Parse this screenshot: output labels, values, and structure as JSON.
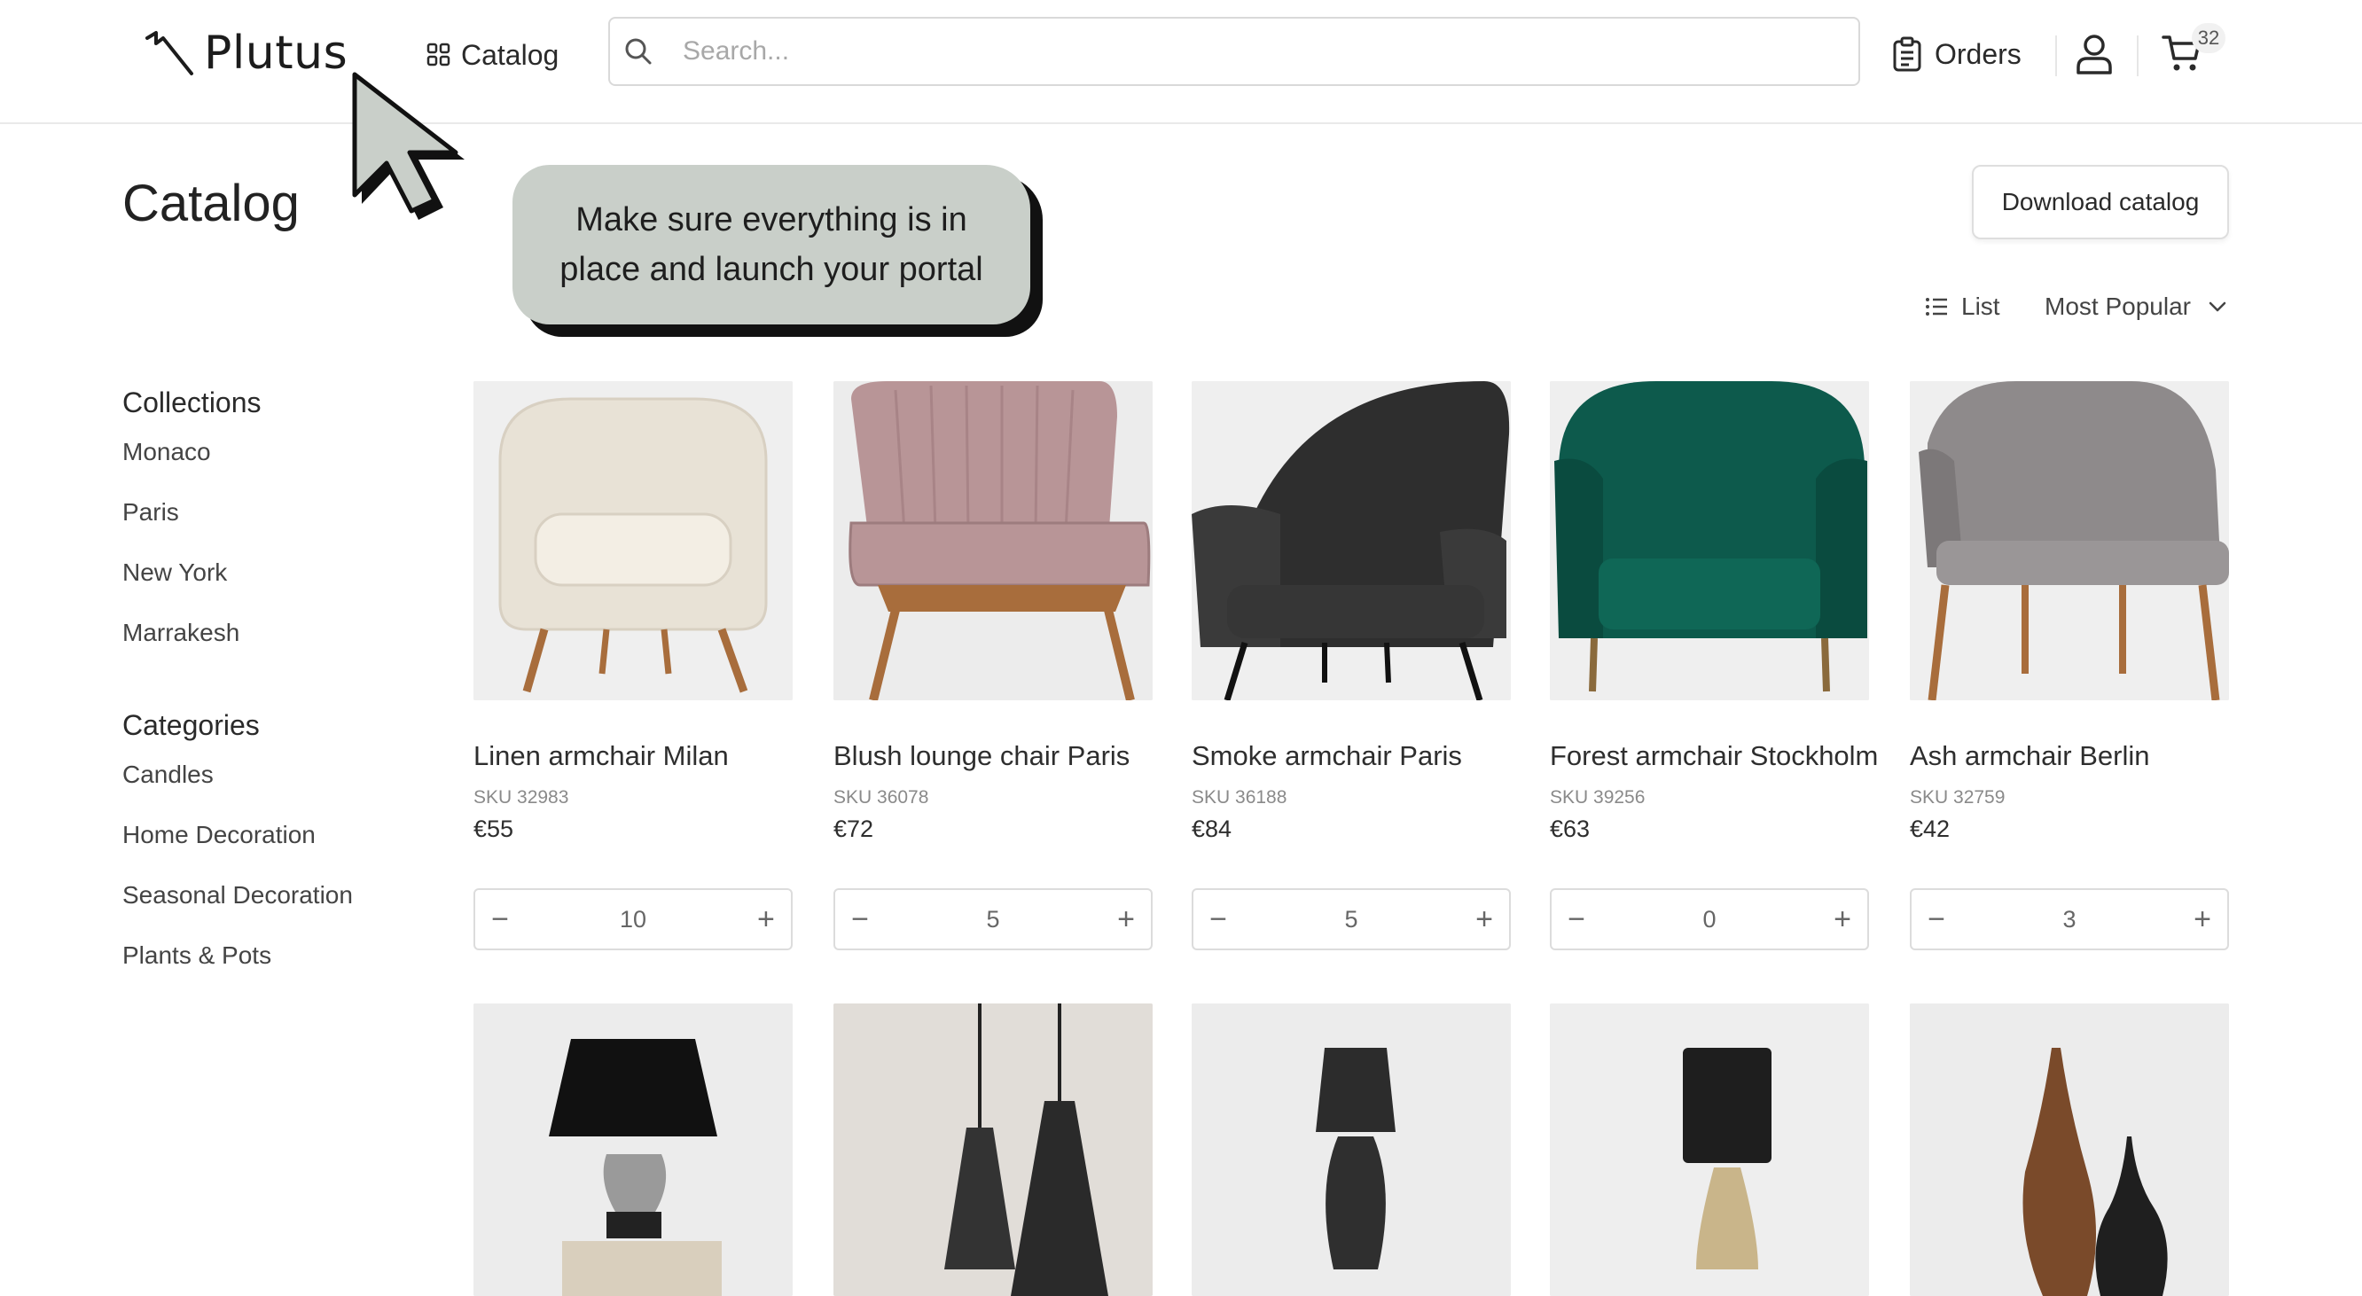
{
  "brand": {
    "name": "Plutus"
  },
  "header": {
    "nav_catalog": "Catalog",
    "search_placeholder": "Search...",
    "orders": "Orders",
    "cart_count": "32"
  },
  "page": {
    "title": "Catalog",
    "download_label": "Download catalog",
    "view_label": "List",
    "sort_label": "Most Popular"
  },
  "sidebar": {
    "collections_heading": "Collections",
    "collections": [
      "Monaco",
      "Paris",
      "New York",
      "Marrakesh"
    ],
    "categories_heading": "Categories",
    "categories": [
      "Candles",
      "Home Decoration",
      "Seasonal Decoration",
      "Plants & Pots"
    ]
  },
  "products": [
    {
      "name": "Linen armchair Milan",
      "sku": "SKU 32983",
      "price": "€55",
      "qty": "10",
      "color": "#e8e2d6"
    },
    {
      "name": "Blush lounge chair Paris",
      "sku": "SKU 36078",
      "price": "€72",
      "qty": "5",
      "color": "#b89597"
    },
    {
      "name": "Smoke armchair Paris",
      "sku": "SKU 36188",
      "price": "€84",
      "qty": "5",
      "color": "#2e2e2e"
    },
    {
      "name": "Forest armchair Stockholm",
      "sku": "SKU 39256",
      "price": "€63",
      "qty": "0",
      "color": "#0d5a4c"
    },
    {
      "name": "Ash armchair Berlin",
      "sku": "SKU 32759",
      "price": "€42",
      "qty": "3",
      "color": "#8e8a8b"
    }
  ],
  "products_row2": [
    {
      "icon": "table-lamp"
    },
    {
      "icon": "pendant-lamps"
    },
    {
      "icon": "table-lamp"
    },
    {
      "icon": "table-lamp"
    },
    {
      "icon": "vases"
    }
  ],
  "callout": {
    "line1": "Make sure everything is in",
    "line2": "place and launch your portal"
  },
  "colors": {
    "accent_callout": "#c9cfc9",
    "border": "#dcdcdc"
  }
}
